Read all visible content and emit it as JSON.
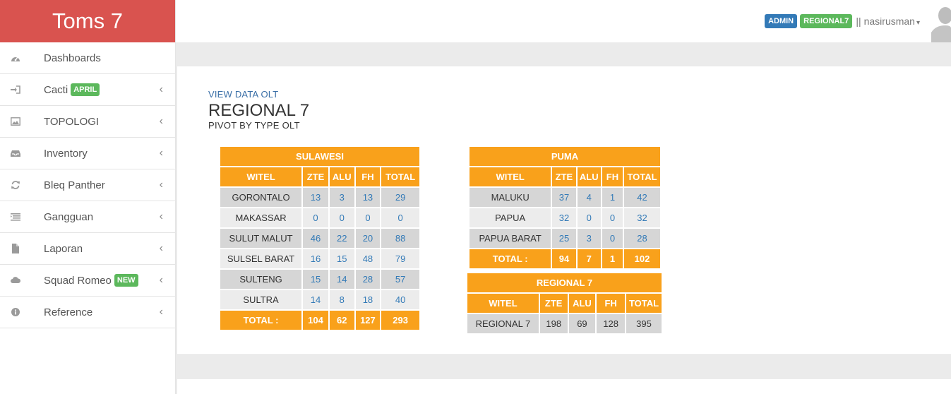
{
  "app": {
    "brand": "Toms 7"
  },
  "sidebar": {
    "items": [
      {
        "label": "Dashboards",
        "icon": "dashboard-icon",
        "badge": "",
        "chevron": ""
      },
      {
        "label": "Cacti",
        "icon": "sign-in-icon",
        "badge": "APRIL",
        "chevron": "‹"
      },
      {
        "label": "TOPOLOGI",
        "icon": "picture-icon",
        "badge": "",
        "chevron": "‹"
      },
      {
        "label": "Inventory",
        "icon": "inbox-icon",
        "badge": "",
        "chevron": "‹"
      },
      {
        "label": "Bleq Panther",
        "icon": "refresh-icon",
        "badge": "",
        "chevron": "‹"
      },
      {
        "label": "Gangguan",
        "icon": "list-icon",
        "badge": "",
        "chevron": "‹"
      },
      {
        "label": "Laporan",
        "icon": "file-icon",
        "badge": "",
        "chevron": "‹"
      },
      {
        "label": "Squad Romeo",
        "icon": "cloud-icon",
        "badge": "NEW",
        "chevron": "‹"
      },
      {
        "label": "Reference",
        "icon": "info-icon",
        "badge": "",
        "chevron": "‹"
      }
    ]
  },
  "topbar": {
    "role_badge": "ADMIN",
    "region_badge": "REGIONAL7",
    "separator": "||",
    "username": "nasirusman",
    "caret": "▾"
  },
  "content": {
    "link": "VIEW DATA OLT",
    "title": "REGIONAL 7",
    "subtitle": "PIVOT BY TYPE OLT"
  },
  "colors": {
    "brand": "#d9534f",
    "table_header": "#f9a11b",
    "badge_blue": "#337ab7",
    "badge_green": "#5cb85c",
    "link": "#337ab7"
  },
  "tables": {
    "sulawesi": {
      "title": "SULAWESI",
      "headers": [
        "WITEL",
        "ZTE",
        "ALU",
        "FH",
        "TOTAL"
      ],
      "rows": [
        [
          "GORONTALO",
          "13",
          "3",
          "13",
          "29"
        ],
        [
          "MAKASSAR",
          "0",
          "0",
          "0",
          "0"
        ],
        [
          "SULUT MALUT",
          "46",
          "22",
          "20",
          "88"
        ],
        [
          "SULSEL BARAT",
          "16",
          "15",
          "48",
          "79"
        ],
        [
          "SULTENG",
          "15",
          "14",
          "28",
          "57"
        ],
        [
          "SULTRA",
          "14",
          "8",
          "18",
          "40"
        ]
      ],
      "total": [
        "TOTAL :",
        "104",
        "62",
        "127",
        "293"
      ]
    },
    "puma": {
      "title": "PUMA",
      "headers": [
        "WITEL",
        "ZTE",
        "ALU",
        "FH",
        "TOTAL"
      ],
      "rows": [
        [
          "MALUKU",
          "37",
          "4",
          "1",
          "42"
        ],
        [
          "PAPUA",
          "32",
          "0",
          "0",
          "32"
        ],
        [
          "PAPUA BARAT",
          "25",
          "3",
          "0",
          "28"
        ]
      ],
      "total": [
        "TOTAL :",
        "94",
        "7",
        "1",
        "102"
      ]
    },
    "regional": {
      "title": "REGIONAL 7",
      "headers": [
        "WITEL",
        "ZTE",
        "ALU",
        "FH",
        "TOTAL"
      ],
      "rows": [
        [
          "REGIONAL 7",
          "198",
          "69",
          "128",
          "395"
        ]
      ]
    }
  }
}
